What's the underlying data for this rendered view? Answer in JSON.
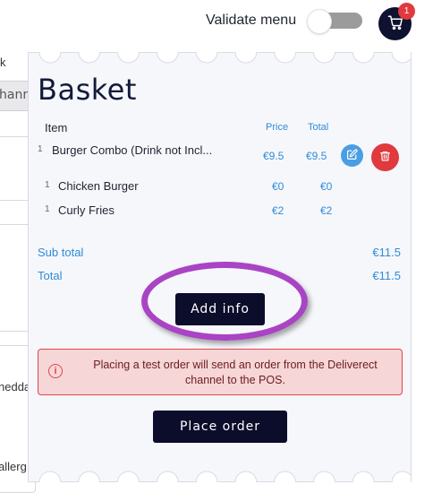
{
  "header": {
    "validate_label": "Validate menu",
    "cart_badge_count": "1",
    "toggle_state": "off"
  },
  "background": {
    "edge_text_1": "k",
    "edge_input_text": "hann",
    "edge_text_2": "hedda",
    "edge_text_3": "allerg"
  },
  "basket": {
    "title": "Basket",
    "columns": {
      "item": "Item",
      "price": "Price",
      "total": "Total"
    },
    "items": [
      {
        "qty": "1",
        "name": "Burger Combo (Drink not Incl...",
        "price": "€9.5",
        "total": "€9.5"
      },
      {
        "qty": "1",
        "name": "Chicken Burger",
        "price": "€0",
        "total": "€0"
      },
      {
        "qty": "1",
        "name": "Curly Fries",
        "price": "€2",
        "total": "€2"
      }
    ],
    "sub_total_label": "Sub total",
    "sub_total_value": "€11.5",
    "total_label": "Total",
    "total_value": "€11.5",
    "add_info_label": "Add info",
    "alert_text": "Placing a test order will send an order from the Deliverect channel to the POS.",
    "place_order_label": "Place order"
  },
  "colors": {
    "accent_blue": "#2f8bd8",
    "dark_button": "#0c0c2b",
    "danger": "#e0393e",
    "highlight": "#a944c4"
  },
  "icons": [
    "cart-icon",
    "edit-icon",
    "trash-icon",
    "info-icon"
  ]
}
